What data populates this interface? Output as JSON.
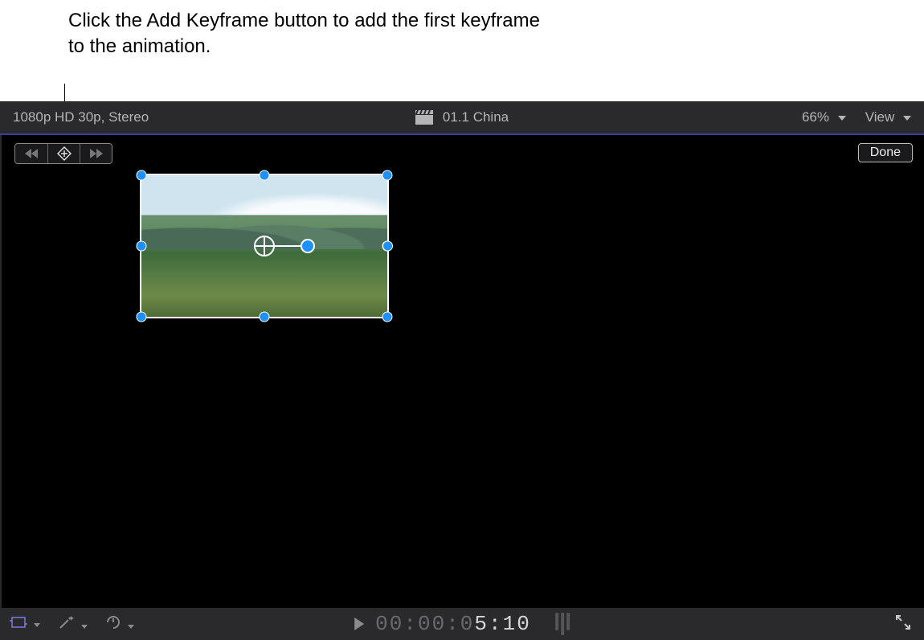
{
  "annotation": {
    "text": "Click the Add Keyframe button to add the first keyframe to the animation."
  },
  "toolbar": {
    "format": "1080p HD 30p, Stereo",
    "clip_title": "01.1 China",
    "zoom_label": "66%",
    "view_label": "View"
  },
  "viewer": {
    "done_label": "Done"
  },
  "keyframe_nav": {
    "prev_tooltip": "Previous Keyframe",
    "add_tooltip": "Add Keyframe",
    "next_tooltip": "Next Keyframe"
  },
  "bottombar": {
    "timecode_dim": "00:00:0",
    "timecode_bright": "5:10"
  }
}
